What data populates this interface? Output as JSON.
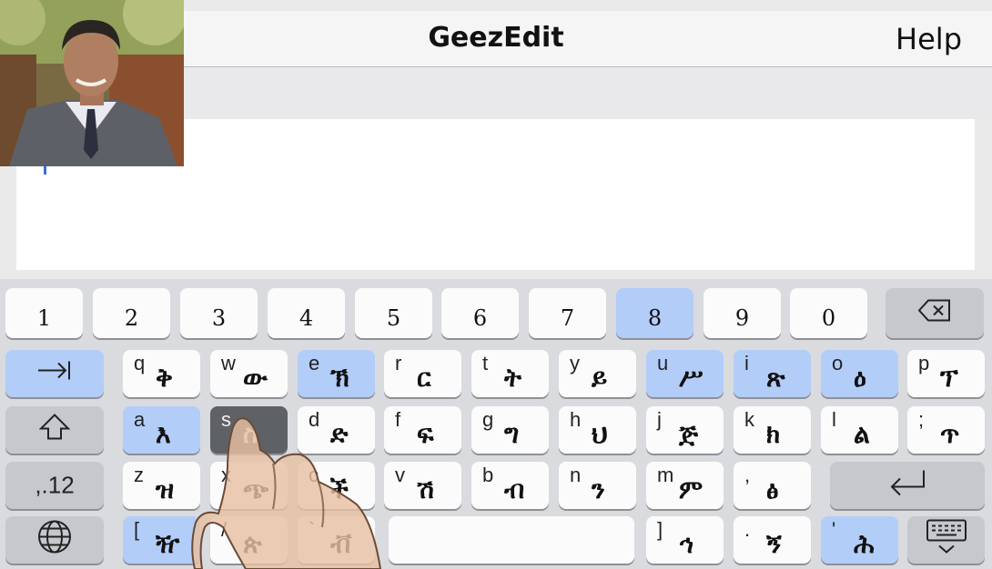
{
  "app": {
    "title": "GeezEdit",
    "help_label": "Help"
  },
  "keyboard": {
    "number_row": [
      "1",
      "2",
      "3",
      "4",
      "5",
      "6",
      "7",
      "8",
      "9",
      "0"
    ],
    "highlight_number": "8",
    "row_q": [
      {
        "lat": "q",
        "eth": "ቅ",
        "hl": false
      },
      {
        "lat": "w",
        "eth": "ው",
        "hl": false
      },
      {
        "lat": "e",
        "eth": "ኽ",
        "hl": true
      },
      {
        "lat": "r",
        "eth": "ር",
        "hl": false
      },
      {
        "lat": "t",
        "eth": "ት",
        "hl": false
      },
      {
        "lat": "y",
        "eth": "ይ",
        "hl": false
      },
      {
        "lat": "u",
        "eth": "ሥ",
        "hl": true
      },
      {
        "lat": "i",
        "eth": "ጽ",
        "hl": true
      },
      {
        "lat": "o",
        "eth": "ዕ",
        "hl": true
      },
      {
        "lat": "p",
        "eth": "ፕ",
        "hl": false
      }
    ],
    "row_a": [
      {
        "lat": "a",
        "eth": "እ",
        "hl": true
      },
      {
        "lat": "s",
        "eth": "ስ",
        "hl": false,
        "pressed": true
      },
      {
        "lat": "d",
        "eth": "ድ",
        "hl": false
      },
      {
        "lat": "f",
        "eth": "ፍ",
        "hl": false
      },
      {
        "lat": "g",
        "eth": "ግ",
        "hl": false
      },
      {
        "lat": "h",
        "eth": "ህ",
        "hl": false
      },
      {
        "lat": "j",
        "eth": "ጅ",
        "hl": false
      },
      {
        "lat": "k",
        "eth": "ክ",
        "hl": false
      },
      {
        "lat": "l",
        "eth": "ል",
        "hl": false
      },
      {
        "lat": ";",
        "eth": "ጥ",
        "hl": false
      }
    ],
    "row_z": [
      {
        "lat": "z",
        "eth": "ዝ",
        "hl": false
      },
      {
        "lat": "x",
        "eth": "ጭ",
        "hl": false
      },
      {
        "lat": "c",
        "eth": "ች",
        "hl": false
      },
      {
        "lat": "v",
        "eth": "ሽ",
        "hl": false
      },
      {
        "lat": "b",
        "eth": "ብ",
        "hl": false
      },
      {
        "lat": "n",
        "eth": "ን",
        "hl": false
      },
      {
        "lat": "m",
        "eth": "ም",
        "hl": false
      },
      {
        "lat": ",",
        "eth": "ፅ",
        "hl": false
      }
    ],
    "row_bottom": [
      {
        "lat": "[",
        "eth": "ዥ",
        "hl": true
      },
      {
        "lat": "/",
        "eth": "ጵ",
        "hl": false
      },
      {
        "lat": "`",
        "eth": "ቭ",
        "hl": false
      },
      {
        "lat": "]",
        "eth": "ኅ",
        "hl": false
      },
      {
        "lat": ".",
        "eth": "ኝ",
        "hl": false
      },
      {
        "lat": "'",
        "eth": "ሕ",
        "hl": true
      }
    ],
    "numbers_label": ",.12",
    "icons": {
      "backspace": "backspace-icon",
      "tab": "tab-icon",
      "shift": "shift-icon",
      "return": "return-icon",
      "globe": "globe-icon",
      "hide": "keyboard-hide-icon"
    },
    "colors": {
      "highlight": "#b3cdf9",
      "pressed": "#5e6165",
      "function_key": "#c6c8cd"
    }
  }
}
